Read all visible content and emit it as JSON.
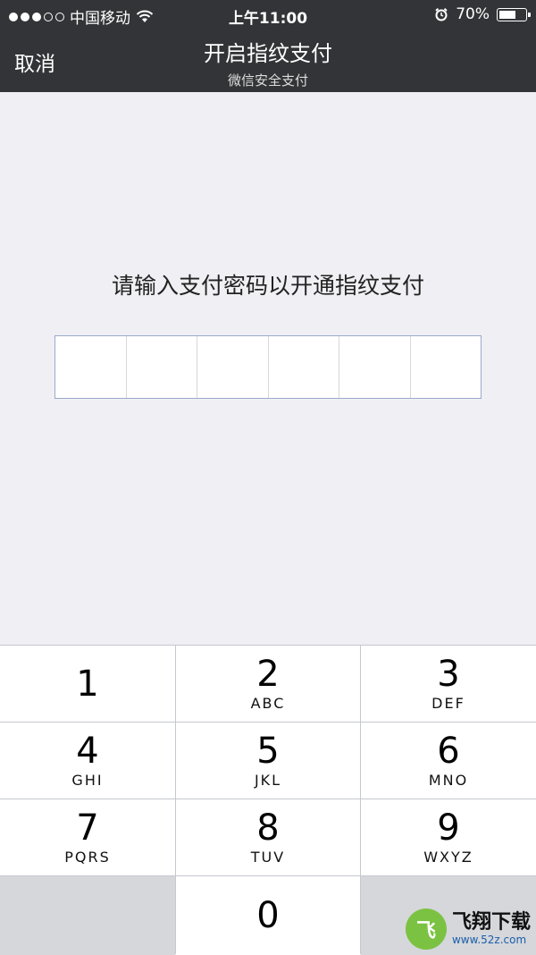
{
  "status_bar": {
    "carrier": "中国移动",
    "time": "上午11:00",
    "battery": "70%",
    "battery_level": 0.7
  },
  "nav": {
    "cancel_label": "取消",
    "title": "开启指纹支付",
    "subtitle": "微信安全支付"
  },
  "prompt": "请输入支付密码以开通指纹支付",
  "pin": {
    "length": 6
  },
  "keypad": {
    "keys": [
      {
        "num": "1",
        "letters": ""
      },
      {
        "num": "2",
        "letters": "ABC"
      },
      {
        "num": "3",
        "letters": "DEF"
      },
      {
        "num": "4",
        "letters": "GHI"
      },
      {
        "num": "5",
        "letters": "JKL"
      },
      {
        "num": "6",
        "letters": "MNO"
      },
      {
        "num": "7",
        "letters": "PQRS"
      },
      {
        "num": "8",
        "letters": "TUV"
      },
      {
        "num": "9",
        "letters": "WXYZ"
      },
      {
        "num": "0",
        "letters": ""
      }
    ]
  },
  "watermark": {
    "brand": "飞翔下载",
    "url": "www.52z.com"
  }
}
